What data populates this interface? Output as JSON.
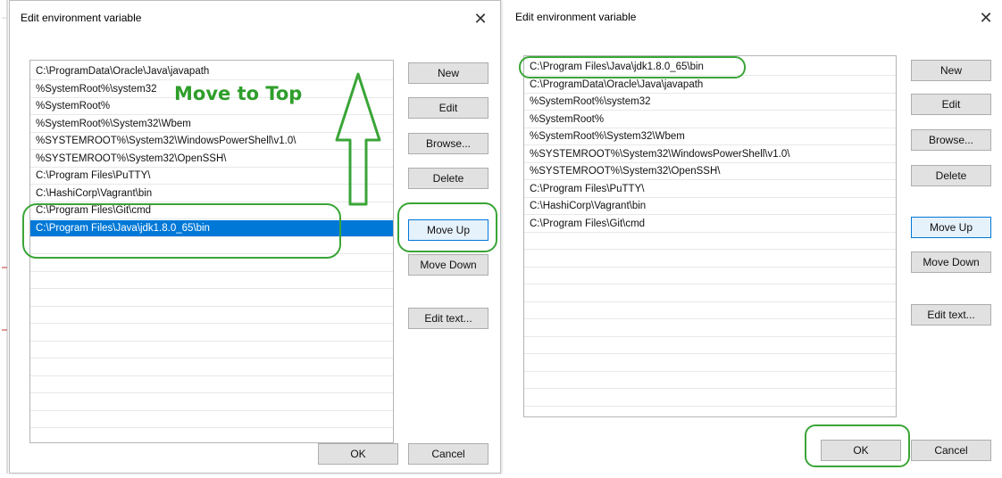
{
  "left_dialog": {
    "title": "Edit environment variable",
    "close": "✕",
    "paths": [
      "C:\\ProgramData\\Oracle\\Java\\javapath",
      "%SystemRoot%\\system32",
      "%SystemRoot%",
      "%SystemRoot%\\System32\\Wbem",
      "%SYSTEMROOT%\\System32\\WindowsPowerShell\\v1.0\\",
      "%SYSTEMROOT%\\System32\\OpenSSH\\",
      "C:\\Program Files\\PuTTY\\",
      "C:\\HashiCorp\\Vagrant\\bin",
      "C:\\Program Files\\Git\\cmd",
      "C:\\Program Files\\Java\\jdk1.8.0_65\\bin"
    ],
    "selected_index": 9,
    "buttons": {
      "new": "New",
      "edit": "Edit",
      "browse": "Browse...",
      "delete": "Delete",
      "move_up": "Move Up",
      "move_down": "Move Down",
      "edit_text": "Edit text...",
      "ok": "OK",
      "cancel": "Cancel"
    },
    "annotation": "Move to Top"
  },
  "right_dialog": {
    "title": "Edit environment variable",
    "close": "✕",
    "paths": [
      "C:\\Program Files\\Java\\jdk1.8.0_65\\bin",
      "C:\\ProgramData\\Oracle\\Java\\javapath",
      "%SystemRoot%\\system32",
      "%SystemRoot%",
      "%SystemRoot%\\System32\\Wbem",
      "%SYSTEMROOT%\\System32\\WindowsPowerShell\\v1.0\\",
      "%SYSTEMROOT%\\System32\\OpenSSH\\",
      "C:\\Program Files\\PuTTY\\",
      "C:\\HashiCorp\\Vagrant\\bin",
      "C:\\Program Files\\Git\\cmd"
    ],
    "buttons": {
      "new": "New",
      "edit": "Edit",
      "browse": "Browse...",
      "delete": "Delete",
      "move_up": "Move Up",
      "move_down": "Move Down",
      "edit_text": "Edit text...",
      "ok": "OK",
      "cancel": "Cancel"
    }
  },
  "colors": {
    "annotation_green": "#3aa537",
    "selection_blue": "#0078d7"
  }
}
